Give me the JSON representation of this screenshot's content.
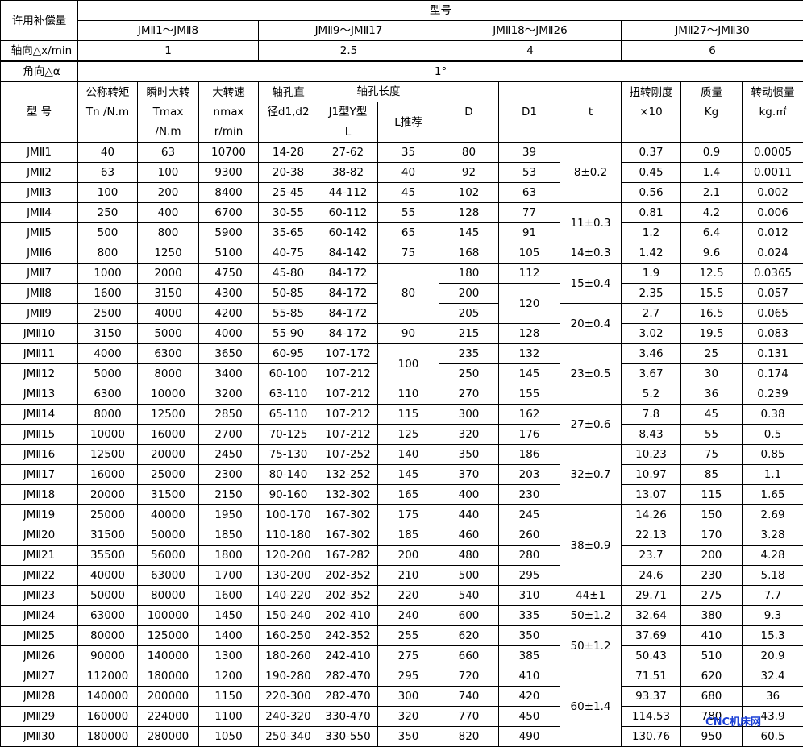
{
  "header": {
    "allow_comp": "许用补偿量",
    "model_group": "型号",
    "ranges": [
      "JMⅡ1～JMⅡ8",
      "JMⅡ9～JMⅡ17",
      "JMⅡ18～JMⅡ26",
      "JMⅡ27～JMⅡ30"
    ],
    "axial_label": "轴向△x/min",
    "axial_values": [
      "1",
      "2.5",
      "4",
      "6"
    ],
    "angular_label": "角向△α",
    "angular_value": "1°",
    "col_model": "型 号",
    "col_tn": [
      "公称转矩",
      "Tn /N.m"
    ],
    "col_tmax": [
      "瞬时大转",
      "Tmax",
      "/N.m"
    ],
    "col_nmax": [
      "大转速",
      "nmax",
      "r/min"
    ],
    "col_bore": [
      "轴孔直",
      "径d1,d2"
    ],
    "col_len": "轴孔长度",
    "col_j1": "J1型Y型",
    "col_l": "L",
    "col_lrec": "L推荐",
    "col_D": "D",
    "col_D1": "D1",
    "col_t": "t",
    "col_stiff": [
      "扭转刚度",
      "×10"
    ],
    "col_mass": [
      "质量",
      "Kg"
    ],
    "col_inertia": [
      "转动惯量",
      "kg.㎡"
    ]
  },
  "rows": [
    {
      "m": "JMⅡ1",
      "tn": "40",
      "tmax": "63",
      "n": "10700",
      "d": "14-28",
      "l": "27-62",
      "lr": "35",
      "D": "80",
      "D1": "39",
      "t": "8±0.2",
      "k": "0.37",
      "kg": "0.9",
      "j": "0.0005"
    },
    {
      "m": "JMⅡ2",
      "tn": "63",
      "tmax": "100",
      "n": "9300",
      "d": "20-38",
      "l": "38-82",
      "lr": "40",
      "D": "92",
      "D1": "53",
      "t": "",
      "k": "0.45",
      "kg": "1.4",
      "j": "0.0011"
    },
    {
      "m": "JMⅡ3",
      "tn": "100",
      "tmax": "200",
      "n": "8400",
      "d": "25-45",
      "l": "44-112",
      "lr": "45",
      "D": "102",
      "D1": "63",
      "t": "",
      "k": "0.56",
      "kg": "2.1",
      "j": "0.002"
    },
    {
      "m": "JMⅡ4",
      "tn": "250",
      "tmax": "400",
      "n": "6700",
      "d": "30-55",
      "l": "60-112",
      "lr": "55",
      "D": "128",
      "D1": "77",
      "t": "11±0.3",
      "k": "0.81",
      "kg": "4.2",
      "j": "0.006"
    },
    {
      "m": "JMⅡ5",
      "tn": "500",
      "tmax": "800",
      "n": "5900",
      "d": "35-65",
      "l": "60-142",
      "lr": "65",
      "D": "145",
      "D1": "91",
      "t": "",
      "k": "1.2",
      "kg": "6.4",
      "j": "0.012"
    },
    {
      "m": "JMⅡ6",
      "tn": "800",
      "tmax": "1250",
      "n": "5100",
      "d": "40-75",
      "l": "84-142",
      "lr": "75",
      "D": "168",
      "D1": "105",
      "t": "14±0.3",
      "k": "1.42",
      "kg": "9.6",
      "j": "0.024"
    },
    {
      "m": "JMⅡ7",
      "tn": "1000",
      "tmax": "2000",
      "n": "4750",
      "d": "45-80",
      "l": "84-172",
      "lr": "80",
      "D": "180",
      "D1": "112",
      "t": "15±0.4",
      "k": "1.9",
      "kg": "12.5",
      "j": "0.0365"
    },
    {
      "m": "JMⅡ8",
      "tn": "1600",
      "tmax": "3150",
      "n": "4300",
      "d": "50-85",
      "l": "84-172",
      "lr": "",
      "D": "200",
      "D1": "120",
      "t": "",
      "k": "2.35",
      "kg": "15.5",
      "j": "0.057"
    },
    {
      "m": "JMⅡ9",
      "tn": "2500",
      "tmax": "4000",
      "n": "4200",
      "d": "55-85",
      "l": "84-172",
      "lr": "",
      "D": "205",
      "D1": "",
      "t": "20±0.4",
      "k": "2.7",
      "kg": "16.5",
      "j": "0.065"
    },
    {
      "m": "JMⅡ10",
      "tn": "3150",
      "tmax": "5000",
      "n": "4000",
      "d": "55-90",
      "l": "84-172",
      "lr": "90",
      "D": "215",
      "D1": "128",
      "t": "",
      "k": "3.02",
      "kg": "19.5",
      "j": "0.083"
    },
    {
      "m": "JMⅡ11",
      "tn": "4000",
      "tmax": "6300",
      "n": "3650",
      "d": "60-95",
      "l": "107-172",
      "lr": "100",
      "D": "235",
      "D1": "132",
      "t": "23±0.5",
      "k": "3.46",
      "kg": "25",
      "j": "0.131"
    },
    {
      "m": "JMⅡ12",
      "tn": "5000",
      "tmax": "8000",
      "n": "3400",
      "d": "60-100",
      "l": "107-212",
      "lr": "",
      "D": "250",
      "D1": "145",
      "t": "",
      "k": "3.67",
      "kg": "30",
      "j": "0.174"
    },
    {
      "m": "JMⅡ13",
      "tn": "6300",
      "tmax": "10000",
      "n": "3200",
      "d": "63-110",
      "l": "107-212",
      "lr": "110",
      "D": "270",
      "D1": "155",
      "t": "",
      "k": "5.2",
      "kg": "36",
      "j": "0.239"
    },
    {
      "m": "JMⅡ14",
      "tn": "8000",
      "tmax": "12500",
      "n": "2850",
      "d": "65-110",
      "l": "107-212",
      "lr": "115",
      "D": "300",
      "D1": "162",
      "t": "27±0.6",
      "k": "7.8",
      "kg": "45",
      "j": "0.38"
    },
    {
      "m": "JMⅡ15",
      "tn": "10000",
      "tmax": "16000",
      "n": "2700",
      "d": "70-125",
      "l": "107-212",
      "lr": "125",
      "D": "320",
      "D1": "176",
      "t": "",
      "k": "8.43",
      "kg": "55",
      "j": "0.5"
    },
    {
      "m": "JMⅡ16",
      "tn": "12500",
      "tmax": "20000",
      "n": "2450",
      "d": "75-130",
      "l": "107-252",
      "lr": "140",
      "D": "350",
      "D1": "186",
      "t": "32±0.7",
      "k": "10.23",
      "kg": "75",
      "j": "0.85"
    },
    {
      "m": "JMⅡ17",
      "tn": "16000",
      "tmax": "25000",
      "n": "2300",
      "d": "80-140",
      "l": "132-252",
      "lr": "145",
      "D": "370",
      "D1": "203",
      "t": "",
      "k": "10.97",
      "kg": "85",
      "j": "1.1"
    },
    {
      "m": "JMⅡ18",
      "tn": "20000",
      "tmax": "31500",
      "n": "2150",
      "d": "90-160",
      "l": "132-302",
      "lr": "165",
      "D": "400",
      "D1": "230",
      "t": "",
      "k": "13.07",
      "kg": "115",
      "j": "1.65"
    },
    {
      "m": "JMⅡ19",
      "tn": "25000",
      "tmax": "40000",
      "n": "1950",
      "d": "100-170",
      "l": "167-302",
      "lr": "175",
      "D": "440",
      "D1": "245",
      "t": "38±0.9",
      "k": "14.26",
      "kg": "150",
      "j": "2.69"
    },
    {
      "m": "JMⅡ20",
      "tn": "31500",
      "tmax": "50000",
      "n": "1850",
      "d": "110-180",
      "l": "167-302",
      "lr": "185",
      "D": "460",
      "D1": "260",
      "t": "",
      "k": "22.13",
      "kg": "170",
      "j": "3.28"
    },
    {
      "m": "JMⅡ21",
      "tn": "35500",
      "tmax": "56000",
      "n": "1800",
      "d": "120-200",
      "l": "167-282",
      "lr": "200",
      "D": "480",
      "D1": "280",
      "t": "",
      "k": "23.7",
      "kg": "200",
      "j": "4.28"
    },
    {
      "m": "JMⅡ22",
      "tn": "40000",
      "tmax": "63000",
      "n": "1700",
      "d": "130-200",
      "l": "202-352",
      "lr": "210",
      "D": "500",
      "D1": "295",
      "t": "",
      "k": "24.6",
      "kg": "230",
      "j": "5.18"
    },
    {
      "m": "JMⅡ23",
      "tn": "50000",
      "tmax": "80000",
      "n": "1600",
      "d": "140-220",
      "l": "202-352",
      "lr": "220",
      "D": "540",
      "D1": "310",
      "t": "44±1",
      "k": "29.71",
      "kg": "275",
      "j": "7.7"
    },
    {
      "m": "JMⅡ24",
      "tn": "63000",
      "tmax": "100000",
      "n": "1450",
      "d": "150-240",
      "l": "202-410",
      "lr": "240",
      "D": "600",
      "D1": "335",
      "t": "50±1.2",
      "k": "32.64",
      "kg": "380",
      "j": "9.3"
    },
    {
      "m": "JMⅡ25",
      "tn": "80000",
      "tmax": "125000",
      "n": "1400",
      "d": "160-250",
      "l": "242-352",
      "lr": "255",
      "D": "620",
      "D1": "350",
      "t": "50±1.2",
      "k": "37.69",
      "kg": "410",
      "j": "15.3"
    },
    {
      "m": "JMⅡ26",
      "tn": "90000",
      "tmax": "140000",
      "n": "1300",
      "d": "180-260",
      "l": "242-410",
      "lr": "275",
      "D": "660",
      "D1": "385",
      "t": "",
      "k": "50.43",
      "kg": "510",
      "j": "20.9"
    },
    {
      "m": "JMⅡ27",
      "tn": "112000",
      "tmax": "180000",
      "n": "1200",
      "d": "190-280",
      "l": "282-470",
      "lr": "295",
      "D": "720",
      "D1": "410",
      "t": "60±1.4",
      "k": "71.51",
      "kg": "620",
      "j": "32.4"
    },
    {
      "m": "JMⅡ28",
      "tn": "140000",
      "tmax": "200000",
      "n": "1150",
      "d": "220-300",
      "l": "282-470",
      "lr": "300",
      "D": "740",
      "D1": "420",
      "t": "",
      "k": "93.37",
      "kg": "680",
      "j": "36"
    },
    {
      "m": "JMⅡ29",
      "tn": "160000",
      "tmax": "224000",
      "n": "1100",
      "d": "240-320",
      "l": "330-470",
      "lr": "320",
      "D": "770",
      "D1": "450",
      "t": "",
      "k": "114.53",
      "kg": "780",
      "j": "43.9"
    },
    {
      "m": "JMⅡ30",
      "tn": "180000",
      "tmax": "280000",
      "n": "1050",
      "d": "250-340",
      "l": "330-550",
      "lr": "350",
      "D": "820",
      "D1": "490",
      "t": "",
      "k": "130.76",
      "kg": "950",
      "j": "60.5"
    }
  ],
  "watermark": "CNC机床网"
}
